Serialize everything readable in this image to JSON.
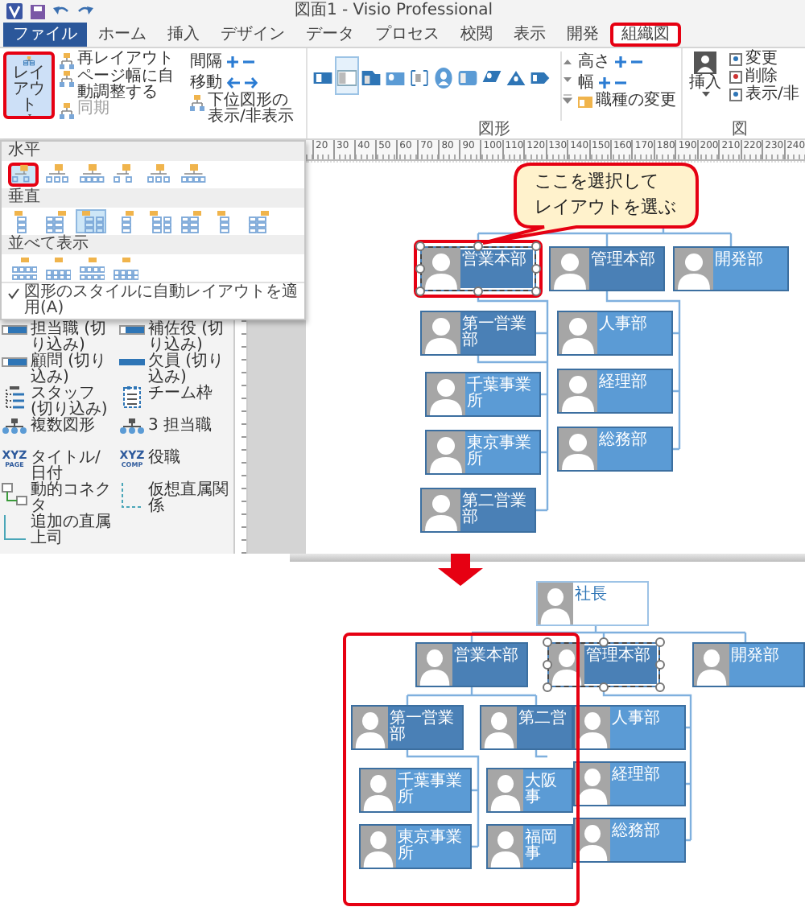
{
  "title_bar": {
    "title": "図面1 - Visio Professional"
  },
  "tabs": [
    {
      "label": "ファイル",
      "kind": "file",
      "selected": false,
      "annotated": false
    },
    {
      "label": "ホーム",
      "kind": "tab",
      "selected": false,
      "annotated": false
    },
    {
      "label": "挿入",
      "kind": "tab",
      "selected": false,
      "annotated": false
    },
    {
      "label": "デザイン",
      "kind": "tab",
      "selected": false,
      "annotated": false
    },
    {
      "label": "データ",
      "kind": "tab",
      "selected": false,
      "annotated": false
    },
    {
      "label": "プロセス",
      "kind": "tab",
      "selected": false,
      "annotated": false
    },
    {
      "label": "校閲",
      "kind": "tab",
      "selected": false,
      "annotated": false
    },
    {
      "label": "表示",
      "kind": "tab",
      "selected": false,
      "annotated": false
    },
    {
      "label": "開発",
      "kind": "tab",
      "selected": false,
      "annotated": false
    },
    {
      "label": "組織図",
      "kind": "tab",
      "selected": true,
      "annotated": true
    }
  ],
  "ribbon": {
    "layout_button": {
      "label": "レイアウト",
      "annotated": true,
      "expanded": true
    },
    "layout_commands": [
      {
        "label": "再レイアウト",
        "disabled": false
      },
      {
        "label": "ページ幅に自動調整する",
        "disabled": false
      },
      {
        "label": "同期",
        "disabled": true
      }
    ],
    "arrange": [
      {
        "label": "間隔",
        "kind": "plusminus"
      },
      {
        "label": "移動",
        "kind": "arrows"
      },
      {
        "label": "下位図形の表示/非表示",
        "kind": "command"
      }
    ],
    "shape_gallery": {
      "group_label": "図形",
      "items": [
        {
          "selected": false
        },
        {
          "selected": true
        },
        {
          "selected": false
        },
        {
          "selected": false
        },
        {
          "selected": false
        },
        {
          "selected": false
        },
        {
          "selected": false
        },
        {
          "selected": false
        },
        {
          "selected": false
        },
        {
          "selected": false
        }
      ]
    },
    "size": [
      {
        "label": "高さ",
        "kind": "plusminus"
      },
      {
        "label": "幅",
        "kind": "plusminus"
      },
      {
        "label": "職種の変更",
        "kind": "command"
      }
    ],
    "picture_group": {
      "insert": "挿入",
      "commands": [
        "変更",
        "削除",
        "表示/非"
      ],
      "group_label": "図"
    }
  },
  "layout_menu": {
    "sections": [
      {
        "title": "水平",
        "kind": "horizontal",
        "items": [
          {
            "selected": true,
            "annotated": true
          },
          {
            "selected": false,
            "annotated": false
          },
          {
            "selected": false,
            "annotated": false
          },
          {
            "selected": false,
            "annotated": false
          },
          {
            "selected": false,
            "annotated": false
          },
          {
            "selected": false,
            "annotated": false
          }
        ]
      },
      {
        "title": "垂直",
        "kind": "vertical",
        "items": [
          {
            "selected": false,
            "annotated": false
          },
          {
            "selected": false,
            "annotated": false
          },
          {
            "selected": true,
            "annotated": false
          },
          {
            "selected": false,
            "annotated": false
          },
          {
            "selected": false,
            "annotated": false
          },
          {
            "selected": false,
            "annotated": false
          },
          {
            "selected": false,
            "annotated": false
          },
          {
            "selected": false,
            "annotated": false
          }
        ]
      },
      {
        "title": "並べて表示",
        "kind": "tiled",
        "items": [
          {
            "selected": false,
            "annotated": false
          },
          {
            "selected": false,
            "annotated": false
          },
          {
            "selected": false,
            "annotated": false
          },
          {
            "selected": false,
            "annotated": false
          }
        ]
      }
    ],
    "auto_style": {
      "label": "図形のスタイルに自動レイアウトを適用(A)",
      "checked": true
    }
  },
  "stencil": [
    {
      "label": "担当職 (切り込み)",
      "kind": "card"
    },
    {
      "label": "補佐役 (切り込み)",
      "kind": "card"
    },
    {
      "label": "顧問 (切り込み)",
      "kind": "card"
    },
    {
      "label": "欠員 (切り込み)",
      "kind": "bar"
    },
    {
      "label": "スタッフ (切り込み)",
      "kind": "staff"
    },
    {
      "label": "チーム枠",
      "kind": "team"
    },
    {
      "label": "複数図形",
      "kind": "multiple"
    },
    {
      "label": "3 担当職",
      "kind": "multiple"
    },
    {
      "label": "タイトル/日付",
      "kind": "text",
      "icon_text": [
        "XYZ",
        "PAGE"
      ]
    },
    {
      "label": "役職",
      "kind": "text",
      "icon_text": [
        "XYZ",
        "COMP"
      ]
    },
    {
      "label": "動的コネクタ",
      "kind": "connector"
    },
    {
      "label": "仮想直属関係",
      "kind": "dotted"
    },
    {
      "label": "追加の直属上司",
      "kind": "line"
    }
  ],
  "ruler": {
    "labels": [
      "20",
      "30",
      "40",
      "50",
      "60",
      "70",
      "80",
      "90",
      "100",
      "110",
      "120",
      "130",
      "140",
      "150",
      "160",
      "170",
      "180",
      "190",
      "200",
      "210",
      "220",
      "230",
      "240"
    ]
  },
  "top_chart": {
    "callout": {
      "lines": [
        "ここを選択して",
        "レイアウトを選ぶ"
      ]
    },
    "nodes": [
      {
        "name": "営業本部",
        "kind": "dark",
        "selected": true
      },
      {
        "name": "管理本部",
        "kind": "dark",
        "selected": false
      },
      {
        "name": "開発部",
        "kind": "light",
        "selected": false
      },
      {
        "name": "第一営業部",
        "kind": "dark",
        "selected": false
      },
      {
        "name": "千葉事業所",
        "kind": "light",
        "selected": false
      },
      {
        "name": "東京事業所",
        "kind": "light",
        "selected": false
      },
      {
        "name": "第二営業部",
        "kind": "dark",
        "selected": false
      },
      {
        "name": "人事部",
        "kind": "light",
        "selected": false
      },
      {
        "name": "経理部",
        "kind": "light",
        "selected": false
      },
      {
        "name": "総務部",
        "kind": "light",
        "selected": false
      }
    ]
  },
  "bottom_chart": {
    "nodes": [
      {
        "name": "社長",
        "kind": "top",
        "selected": false
      },
      {
        "name": "営業本部",
        "kind": "dark",
        "selected": false
      },
      {
        "name": "管理本部",
        "kind": "dark",
        "selected": true
      },
      {
        "name": "開発部",
        "kind": "light",
        "selected": false
      },
      {
        "name": "第一営業部",
        "kind": "dark",
        "selected": false
      },
      {
        "name": "第二営",
        "kind": "dark",
        "selected": false
      },
      {
        "name": "千葉事業所",
        "kind": "light",
        "selected": false
      },
      {
        "name": "大阪事",
        "kind": "light",
        "selected": false
      },
      {
        "name": "東京事業所",
        "kind": "light",
        "selected": false
      },
      {
        "name": "福岡事",
        "kind": "light",
        "selected": false
      },
      {
        "name": "人事部",
        "kind": "light",
        "selected": false
      },
      {
        "name": "経理部",
        "kind": "light",
        "selected": false
      },
      {
        "name": "総務部",
        "kind": "light",
        "selected": false
      }
    ]
  }
}
